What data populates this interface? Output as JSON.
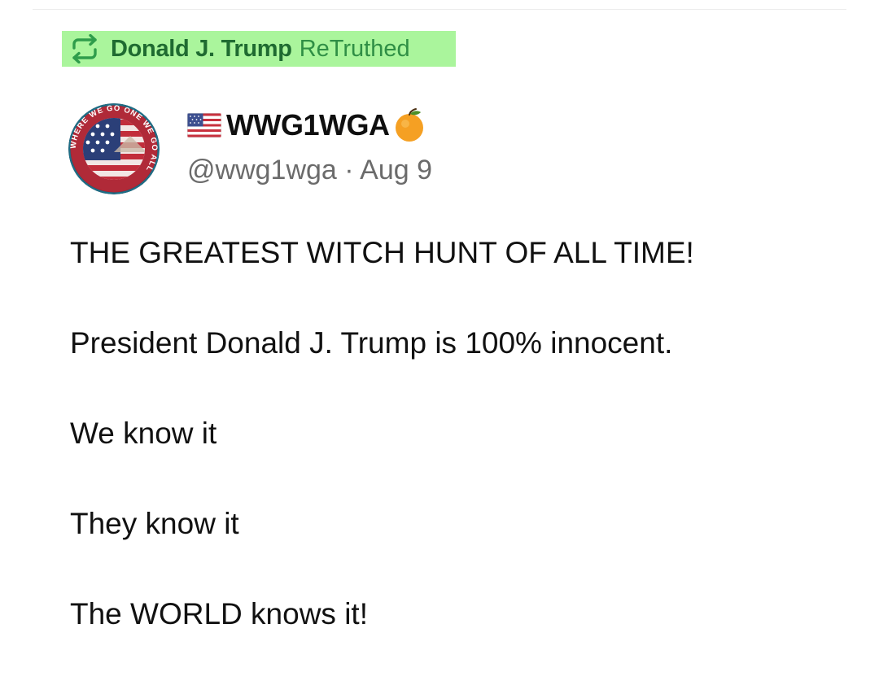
{
  "retruth": {
    "icon": "repost-icon",
    "name": "Donald J. Trump",
    "verb": "ReTruthed",
    "highlight_color": "#aaf59c",
    "text_color": "#1f6b31"
  },
  "author": {
    "avatar": "wwg1wga-avatar",
    "flag_icon": "us-flag-icon",
    "display_name": "WWG1WGA",
    "badge_icon": "orange-icon",
    "handle": "@wwg1wga",
    "separator": "·",
    "date": "Aug 9"
  },
  "avatar_ring_text": "WHERE WE GO ONE WE GO ALL",
  "post": {
    "lines": [
      "THE GREATEST WITCH HUNT OF ALL TIME!",
      "President Donald J. Trump is 100% innocent.",
      "We know it",
      "They know it",
      "The WORLD knows it!"
    ]
  }
}
